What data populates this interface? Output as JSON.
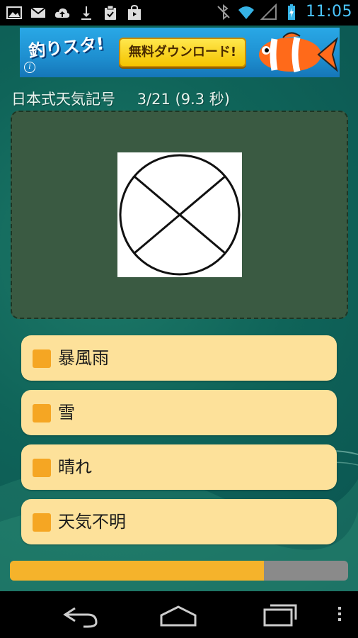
{
  "status_bar": {
    "time": "11:05",
    "left_icons": [
      "gallery-icon",
      "gmail-icon",
      "cloud-upload-icon",
      "download-icon",
      "clipboard-check-icon",
      "store-bag-icon"
    ],
    "right_icons": [
      "bluetooth-off-icon",
      "wifi-icon",
      "signal-icon",
      "battery-charging-icon"
    ]
  },
  "ad": {
    "logo_text": "釣りスタ!",
    "button_text": "無料ダウンロード!",
    "info_glyph": "i"
  },
  "quiz": {
    "title": "日本式天気記号",
    "progress": "3/21 (9.3 秒)",
    "symbol": "circle-with-x"
  },
  "choices": [
    {
      "label": "暴風雨"
    },
    {
      "label": "雪"
    },
    {
      "label": "晴れ"
    },
    {
      "label": "天気不明"
    }
  ],
  "timer": {
    "remaining_fraction": 0.75,
    "fill_color": "#f5b32b",
    "track_color": "#8a8a8a"
  },
  "navbar": {
    "buttons": [
      "back-icon",
      "home-icon",
      "recent-apps-icon",
      "menu-overflow-icon"
    ]
  }
}
